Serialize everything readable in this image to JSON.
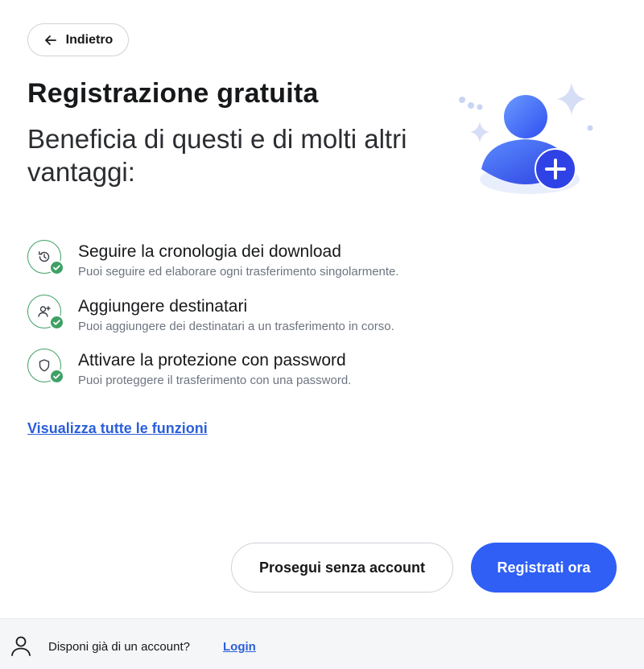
{
  "header": {
    "back_label": "Indietro"
  },
  "hero": {
    "title": "Registrazione gratuita",
    "subtitle": "Beneficia di questi e di molti altri vantaggi:",
    "illustration": "add-user-icon"
  },
  "features": [
    {
      "icon": "history-icon",
      "title": "Seguire la cronologia dei download",
      "desc": "Puoi seguire ed elaborare ogni trasferimento singolarmente."
    },
    {
      "icon": "add-recipient-icon",
      "title": "Aggiungere destinatari",
      "desc": "Puoi aggiungere dei destinatari a un trasferimento in corso."
    },
    {
      "icon": "shield-icon",
      "title": "Attivare la protezione con password",
      "desc": "Puoi proteggere il trasferimento con una password."
    }
  ],
  "all_features_link": "Visualizza tutte le funzioni",
  "actions": {
    "continue_label": "Prosegui senza account",
    "register_label": "Registrati ora"
  },
  "footer": {
    "question": "Disponi già di un account?",
    "login_label": "Login"
  },
  "colors": {
    "primary": "#2f5ff5",
    "link": "#2b5fd9",
    "success": "#3fa065",
    "text": "#17181a",
    "muted": "#6e7480",
    "footer_bg": "#f5f6f8"
  }
}
